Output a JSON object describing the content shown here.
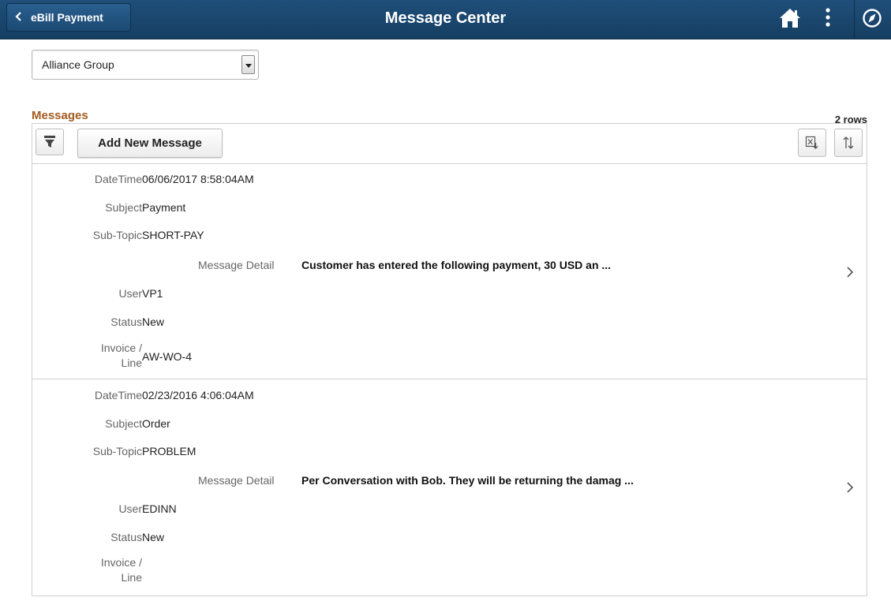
{
  "header": {
    "back_label": "eBill Payment",
    "title": "Message Center",
    "icons": [
      "chevron-left-icon",
      "home-icon",
      "kebab-menu-icon",
      "navbar-compass-icon"
    ]
  },
  "business_unit": {
    "selected": "Alliance Group"
  },
  "grid": {
    "title": "Messages",
    "row_count": "2 rows",
    "add_button_label": "Add New Message",
    "labels": {
      "datetime": "DateTime",
      "subject": "Subject",
      "subtopic": "Sub-Topic",
      "message_detail": "Message Detail",
      "user": "User",
      "status": "Status",
      "invoice_line_1": "Invoice /",
      "invoice_line_2": "Line"
    },
    "rows": [
      {
        "datetime": "06/06/2017  8:58:04AM",
        "subject": "Payment",
        "subtopic": "SHORT-PAY",
        "message_detail": "Customer has entered the following payment, 30  USD an ...",
        "user": "VP1",
        "status": "New",
        "invoice_line": "AW-WO-4"
      },
      {
        "datetime": "02/23/2016  4:06:04AM",
        "subject": "Order",
        "subtopic": "PROBLEM",
        "message_detail": "Per Conversation with Bob.  They will be returning the damag ...",
        "user": "EDINN",
        "status": "New",
        "invoice_line": ""
      }
    ]
  },
  "colors": {
    "header_bg": "#1f4f7a",
    "grid_title": "#a35b1e"
  }
}
